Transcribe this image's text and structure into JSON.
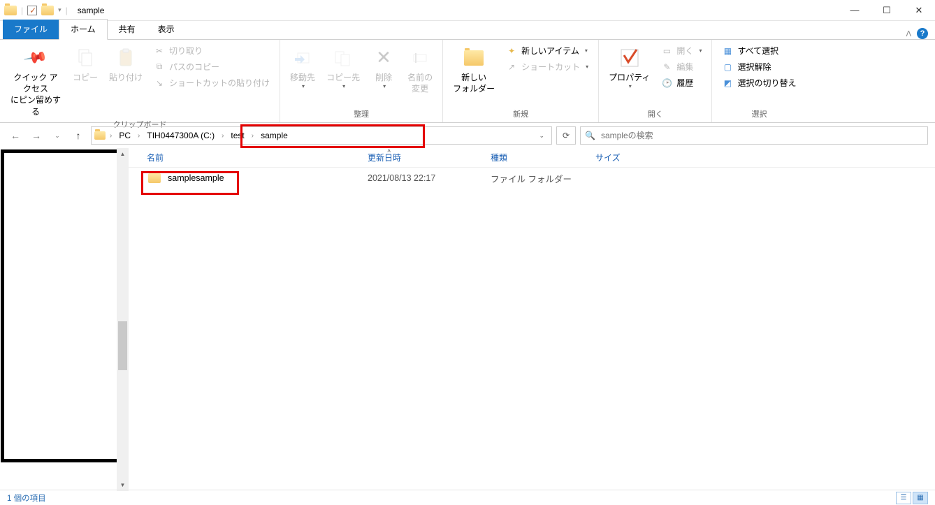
{
  "window": {
    "title": "sample"
  },
  "tabs": {
    "file": "ファイル",
    "home": "ホーム",
    "share": "共有",
    "view": "表示"
  },
  "ribbon": {
    "clipboard": {
      "label": "クリップボード",
      "pin": "クイック アクセス\nにピン留めする",
      "copy": "コピー",
      "paste": "貼り付け",
      "cut": "切り取り",
      "copy_path": "パスのコピー",
      "paste_shortcut": "ショートカットの貼り付け"
    },
    "organize": {
      "label": "整理",
      "move_to": "移動先",
      "copy_to": "コピー先",
      "delete": "削除",
      "rename": "名前の\n変更"
    },
    "new": {
      "label": "新規",
      "new_folder": "新しい\nフォルダー",
      "new_item": "新しいアイテム",
      "shortcut": "ショートカット"
    },
    "open": {
      "label": "開く",
      "properties": "プロパティ",
      "open": "開く",
      "edit": "編集",
      "history": "履歴"
    },
    "select": {
      "label": "選択",
      "select_all": "すべて選択",
      "select_none": "選択解除",
      "invert": "選択の切り替え"
    }
  },
  "breadcrumb": {
    "pc": "PC",
    "drive": "TIH0447300A (C:)",
    "folder1": "test",
    "folder2": "sample"
  },
  "search": {
    "placeholder": "sampleの検索"
  },
  "columns": {
    "name": "名前",
    "date": "更新日時",
    "type": "種類",
    "size": "サイズ"
  },
  "items": [
    {
      "name": "samplesample",
      "date": "2021/08/13 22:17",
      "type": "ファイル フォルダー",
      "size": ""
    }
  ],
  "status": {
    "count": "1 個の項目"
  }
}
